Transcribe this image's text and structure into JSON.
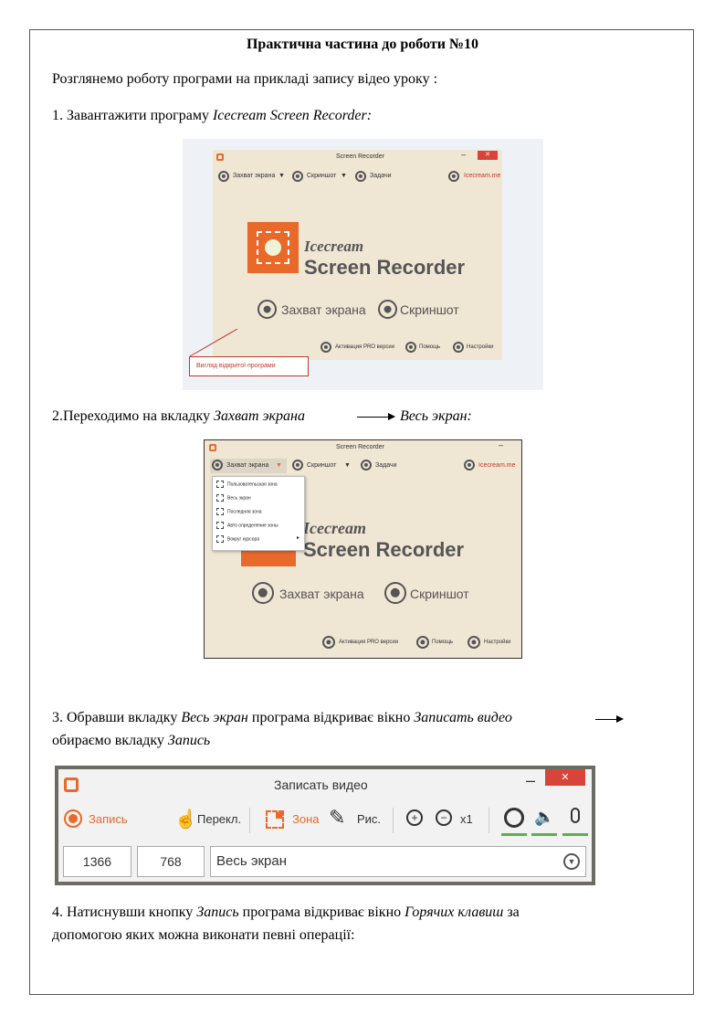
{
  "doc": {
    "title": "Практична частина до роботи №10",
    "intro": "Розглянемо роботу програми на прикладі запису відео уроку :",
    "step1_prefix": "1. Завантажити програму ",
    "step1_italic": "Icecream Screen Recorder:",
    "step2_prefix": "2.Переходимо на вкладку ",
    "step2_italic1": "Захват экрана",
    "step2_italic2": "Весь экран:",
    "step3_a": "3. Обравши вкладку ",
    "step3_b": "Весь экран",
    "step3_c": " програма відкриває вікно ",
    "step3_d": "Записать видео",
    "step3_line2_a": "обираємо вкладку ",
    "step3_line2_b": "Запись",
    "step4_a": "4. Натиснувши кнопку ",
    "step4_b": "Запись",
    "step4_c": " програма відкриває вікно ",
    "step4_d": "Горячих клавиш",
    "step4_e": " за",
    "step4_line2": "допомогою яких можна виконати певні операції:"
  },
  "screenshot1": {
    "window_title": "Screen Recorder",
    "close": "✕",
    "tab_capture": "Захват экрана",
    "tab_screenshot": "Скриншот",
    "tab_tasks": "Задачи",
    "site": "Icecream.me",
    "brand_line1": "Icecream",
    "brand_line2": "Screen Recorder",
    "btn_capture": "Захват экрана",
    "btn_screenshot": "Скриншот",
    "activate": "Активация PRO версии",
    "help": "Помощь",
    "settings": "Настройки",
    "callout": "Вигляд відкритої програми",
    "accent": "#e8692a"
  },
  "screenshot2": {
    "window_title": "Screen Recorder",
    "tab_capture": "Захват экрана",
    "tab_screenshot": "Скриншот",
    "tab_tasks": "Задачи",
    "site": "Icecream.me",
    "menu": [
      "Пользовательская зона",
      "Весь экран",
      "Последняя зона",
      "Авто определение зоны",
      "Вокруг курсора"
    ],
    "brand_line1": "Icecream",
    "brand_line2": "Screen Recorder",
    "btn_capture": "Захват экрана",
    "btn_screenshot": "Скриншот",
    "activate": "Активация PRO версии",
    "help": "Помощь",
    "settings": "Настройки"
  },
  "screenshot3": {
    "window_title": "Записать видео",
    "minimize": "–",
    "close": "✕",
    "record": "Запись",
    "switch": "Перекл.",
    "zone": "Зона",
    "draw": "Рис.",
    "zoom": "x1",
    "width": "1366",
    "height": "768",
    "area": "Весь экран"
  }
}
